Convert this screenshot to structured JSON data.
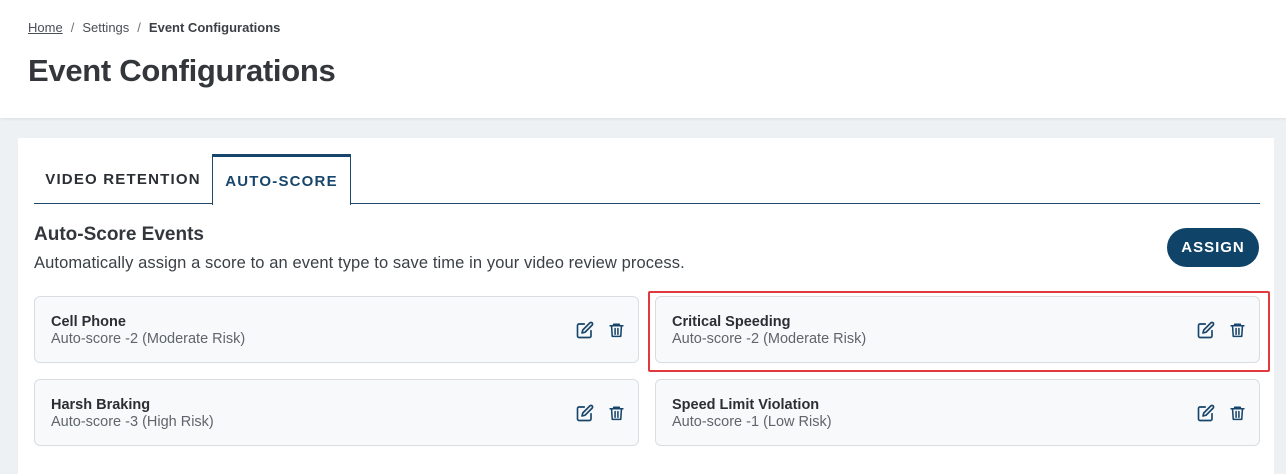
{
  "breadcrumb": {
    "home": "Home",
    "settings": "Settings",
    "current": "Event Configurations",
    "separator": "/"
  },
  "page": {
    "title": "Event Configurations"
  },
  "tabs": [
    {
      "label": "VIDEO RETENTION",
      "active": false
    },
    {
      "label": "AUTO-SCORE",
      "active": true
    }
  ],
  "section": {
    "title": "Auto-Score Events",
    "description": "Automatically assign a score to an event type to save time in your video review process.",
    "assign_label": "ASSIGN"
  },
  "events": [
    {
      "name": "Cell Phone",
      "score": "Auto-score -2 (Moderate Risk)"
    },
    {
      "name": "Critical Speeding",
      "score": "Auto-score -2 (Moderate Risk)",
      "highlighted": true
    },
    {
      "name": "Harsh Braking",
      "score": "Auto-score -3 (High Risk)"
    },
    {
      "name": "Speed Limit Violation",
      "score": "Auto-score -1 (Low Risk)"
    }
  ],
  "icons": {
    "edit": "edit-icon",
    "delete": "trash-icon"
  },
  "colors": {
    "brand": "#0f4468",
    "highlight": "#e0393e",
    "icon": "#17456b"
  }
}
